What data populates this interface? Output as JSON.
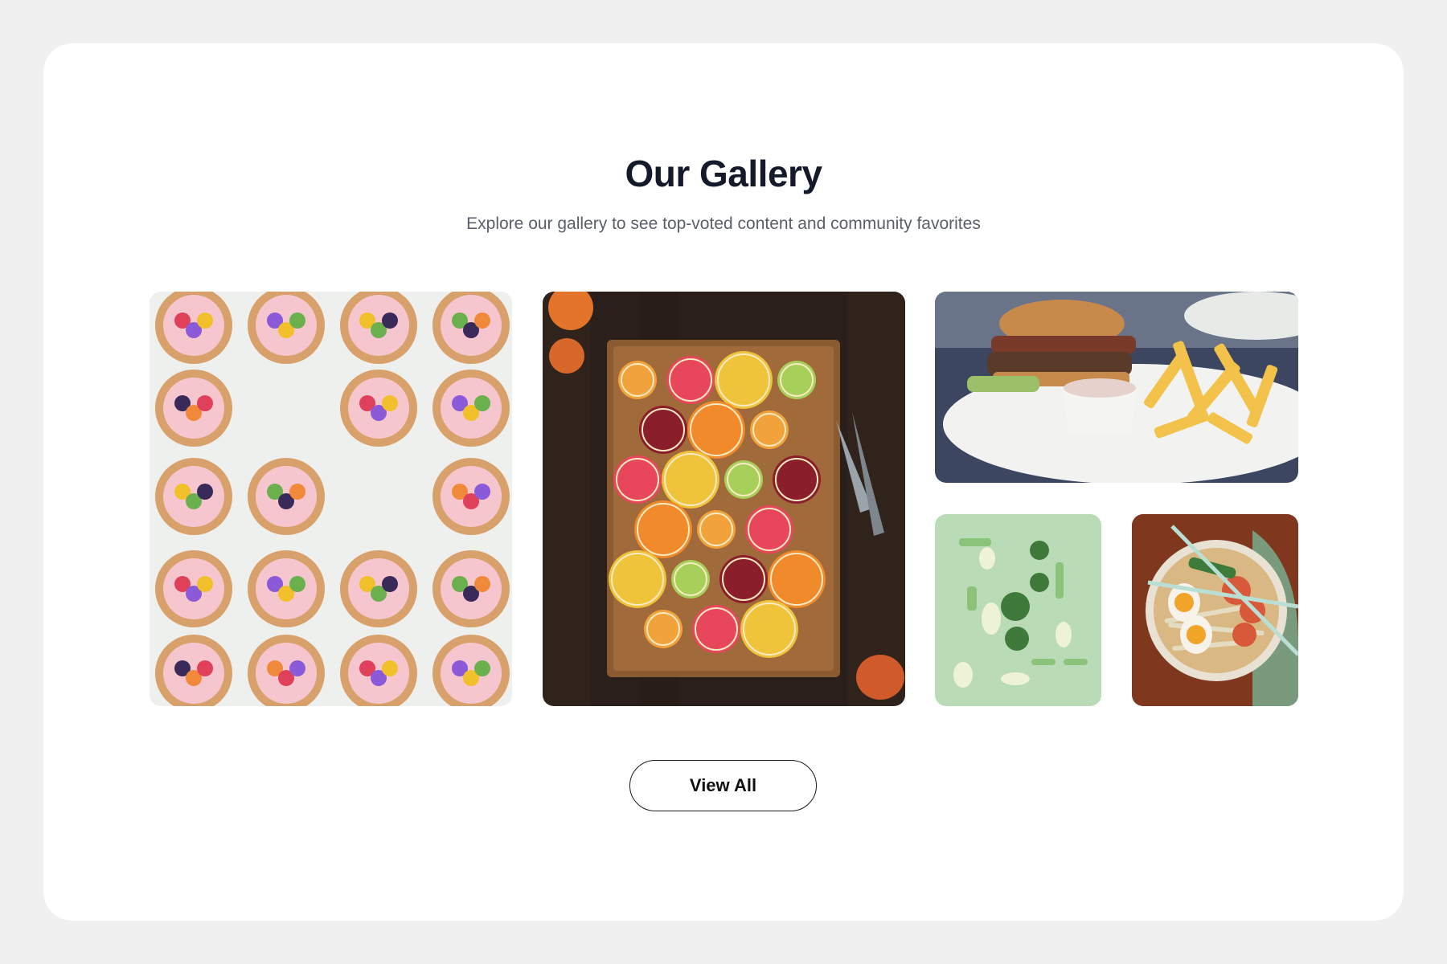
{
  "gallery": {
    "title": "Our Gallery",
    "subtitle": "Explore our gallery to see top-voted content and community favorites",
    "view_all_label": "View All",
    "images": [
      {
        "subject": "flower-topped cupcakes arranged in a frame",
        "icon": "cupcakes-photo"
      },
      {
        "subject": "sliced citrus fruits on wooden board",
        "icon": "citrus-photo"
      },
      {
        "subject": "burger with fries and dip",
        "icon": "burger-photo"
      },
      {
        "subject": "cut green vegetables on mint background",
        "icon": "vegetables-photo"
      },
      {
        "subject": "ramen bowl with eggs and chopsticks",
        "icon": "ramen-photo"
      }
    ]
  },
  "colors": {
    "page_background": "#f0f0f0",
    "card_background": "#ffffff",
    "title": "#141a29",
    "subtitle": "#5a5f6b",
    "button_border": "#1a1a1a"
  }
}
